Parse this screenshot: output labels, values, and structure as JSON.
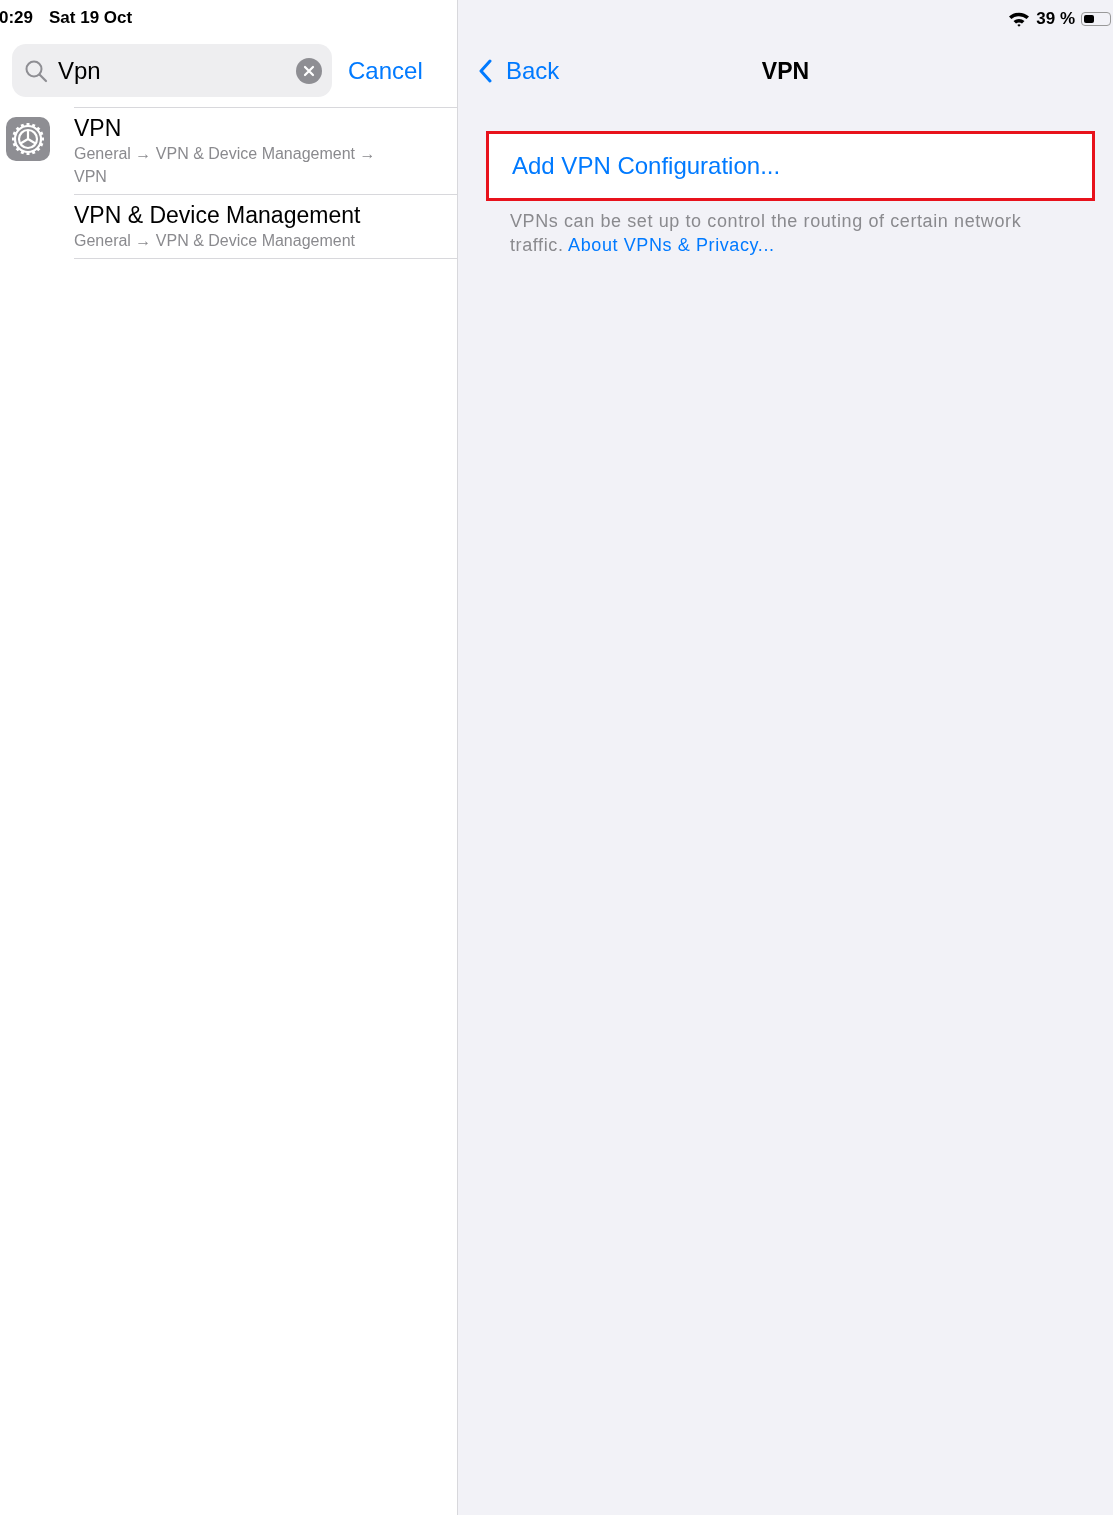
{
  "status_bar": {
    "time": "0:29",
    "date": "Sat 19 Oct",
    "battery": "39 %"
  },
  "search": {
    "value": "Vpn",
    "cancel": "Cancel"
  },
  "results": [
    {
      "title": "VPN",
      "path": "General → VPN & Device Management → VPN"
    },
    {
      "title": "VPN & Device Management",
      "path": "General → VPN & Device Management"
    }
  ],
  "nav": {
    "back": "Back",
    "title": "VPN"
  },
  "rows": [
    {
      "label": "Add VPN Configuration...",
      "highlighted": true
    }
  ],
  "footer": {
    "text": "VPNs can be set up to control the routing of certain network traffic.",
    "link": "About VPNs & Privacy..."
  }
}
